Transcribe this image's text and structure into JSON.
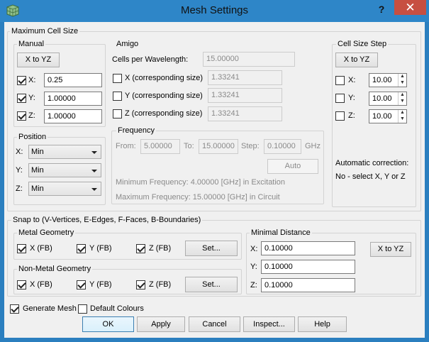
{
  "window": {
    "title": "Mesh Settings",
    "help_glyph": "?",
    "close_glyph": "✕"
  },
  "max_cell_size": {
    "title": "Maximum Cell Size",
    "manual": {
      "title": "Manual",
      "x_to_yz": "X to YZ",
      "x": {
        "label": "X:",
        "checked": true,
        "value": "0.25"
      },
      "y": {
        "label": "Y:",
        "checked": true,
        "value": "1.00000"
      },
      "z": {
        "label": "Z:",
        "checked": true,
        "value": "1.00000"
      }
    },
    "position": {
      "title": "Position",
      "x": {
        "label": "X:",
        "value": "Min"
      },
      "y": {
        "label": "Y:",
        "value": "Min"
      },
      "z": {
        "label": "Z:",
        "value": "Min"
      }
    },
    "amigo": {
      "title": "Amigo",
      "cells_per_wavelength_label": "Cells per Wavelength:",
      "cells_per_wavelength": "15.00000",
      "x_label": "X (corresponding size)",
      "x_value": "1.33241",
      "y_label": "Y (corresponding size)",
      "y_value": "1.33241",
      "z_label": "Z (corresponding size)",
      "z_value": "1.33241",
      "frequency": {
        "title": "Frequency",
        "from_label": "From:",
        "from": "5.00000",
        "to_label": "To:",
        "to": "15.00000",
        "step_label": "Step:",
        "step": "0.10000",
        "unit": "GHz",
        "auto": "Auto",
        "min_freq": "Minimum Frequency: 4.00000 [GHz] in Excitation",
        "max_freq": "Maximum Frequency: 15.00000 [GHz] in Circuit"
      }
    },
    "cell_size_step": {
      "title": "Cell Size Step",
      "x_to_yz": "X to YZ",
      "x": {
        "label": "X:",
        "value": "10.00"
      },
      "y": {
        "label": "Y:",
        "value": "10.00"
      },
      "z": {
        "label": "Z:",
        "value": "10.00"
      },
      "auto_correction_title": "Automatic correction:",
      "auto_correction_text": "No - select X, Y or Z"
    }
  },
  "snap": {
    "title": "Snap to (V-Vertices, E-Edges, F-Faces, B-Boundaries)",
    "metal": {
      "title": "Metal Geometry",
      "x": "X (FB)",
      "y": "Y (FB)",
      "z": "Z (FB)",
      "set": "Set..."
    },
    "nonmetal": {
      "title": "Non-Metal Geometry",
      "x": "X (FB)",
      "y": "Y (FB)",
      "z": "Z (FB)",
      "set": "Set..."
    },
    "minimal_distance": {
      "title": "Minimal Distance",
      "x_label": "X:",
      "x": "0.10000",
      "y_label": "Y:",
      "y": "0.10000",
      "z_label": "Z:",
      "z": "0.10000",
      "x_to_yz": "X to YZ"
    }
  },
  "footer": {
    "generate_mesh": "Generate Mesh",
    "default_colours": "Default Colours",
    "ok": "OK",
    "apply": "Apply",
    "cancel": "Cancel",
    "inspect": "Inspect...",
    "help": "Help"
  }
}
